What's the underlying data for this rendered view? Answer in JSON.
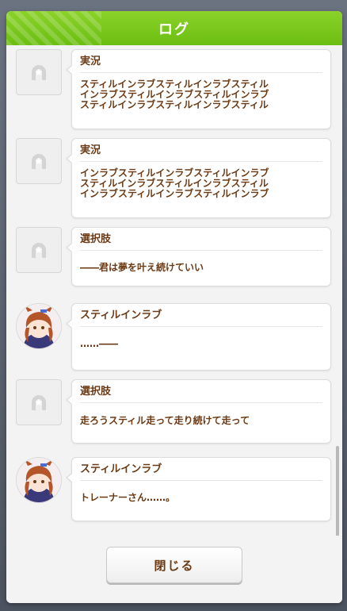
{
  "dialog": {
    "title": "ログ",
    "close_label": "閉じる"
  },
  "entries": [
    {
      "speaker": "実況",
      "text": "スティルインラブスティルインラブスティル\nインラブスティルインラブスティルインラブ\nスティルインラブスティルインラブスティル",
      "avatar": "placeholder-horseshoe-icon"
    },
    {
      "speaker": "実況",
      "text": "インラブスティルインラブスティルインラブ\nスティルインラブスティルインラブスティル\nインラブスティルインラブスティルインラブ",
      "avatar": "placeholder-horseshoe-icon"
    },
    {
      "speaker": "選択肢",
      "text": "――君は夢を叶え続けていい",
      "avatar": "placeholder-horseshoe-icon"
    },
    {
      "speaker": "スティルインラブ",
      "text": "……――",
      "avatar": "character-portrait"
    },
    {
      "speaker": "選択肢",
      "text": "走ろうスティル走って走り続けて走って",
      "avatar": "placeholder-horseshoe-icon"
    },
    {
      "speaker": "スティルインラブ",
      "text": "トレーナーさん……。",
      "avatar": "character-portrait"
    }
  ],
  "colors": {
    "header": "#7cc81e",
    "text": "#6b3a14"
  }
}
